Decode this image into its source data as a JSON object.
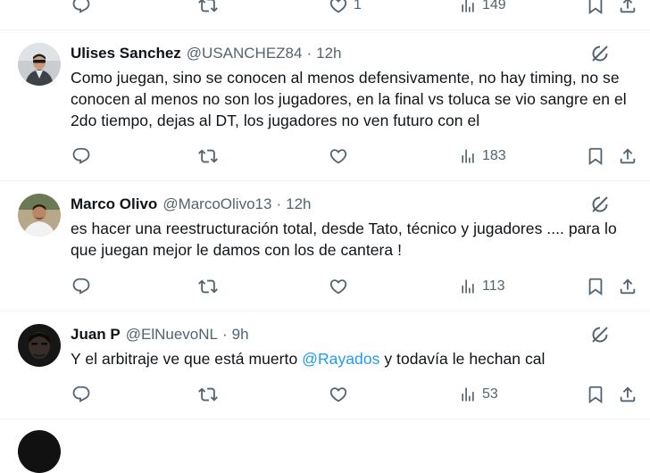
{
  "top_actions": {
    "likes": "1",
    "views": "149"
  },
  "tweets": [
    {
      "name": "Ulises Sanchez",
      "handle": "@USANCHEZ84",
      "time": "12h",
      "text": "Como juegan, sino se conocen al menos defensivamente, no hay timing, no se conocen al menos no son los jugadores, en la final vs toluca se vio sangre en el 2do tiempo, dejas al DT, los jugadores no ven futuro con el",
      "views": "183"
    },
    {
      "name": "Marco Olivo",
      "handle": "@MarcoOlivo13",
      "time": "12h",
      "text": "es hacer una reestructuración total, desde Tato, técnico y jugadores .... para lo que juegan mejor le damos con los de cantera !",
      "views": "113"
    },
    {
      "name": "Juan P",
      "handle": "@ElNuevoNL",
      "time": "9h",
      "text_before": "Y el arbitraje ve que está muerto ",
      "mention": "@Rayados",
      "text_after": " y todavía le hechan cal",
      "views": "53"
    }
  ],
  "icons": {
    "reply": "reply-icon",
    "retweet": "retweet-icon",
    "like": "heart-icon",
    "views": "views-icon",
    "bookmark": "bookmark-icon",
    "share": "share-icon",
    "grok": "grok-icon"
  },
  "colors": {
    "text": "#0f1419",
    "secondary": "#536471",
    "link": "#1d9bf0",
    "divider": "#eff3f4"
  }
}
